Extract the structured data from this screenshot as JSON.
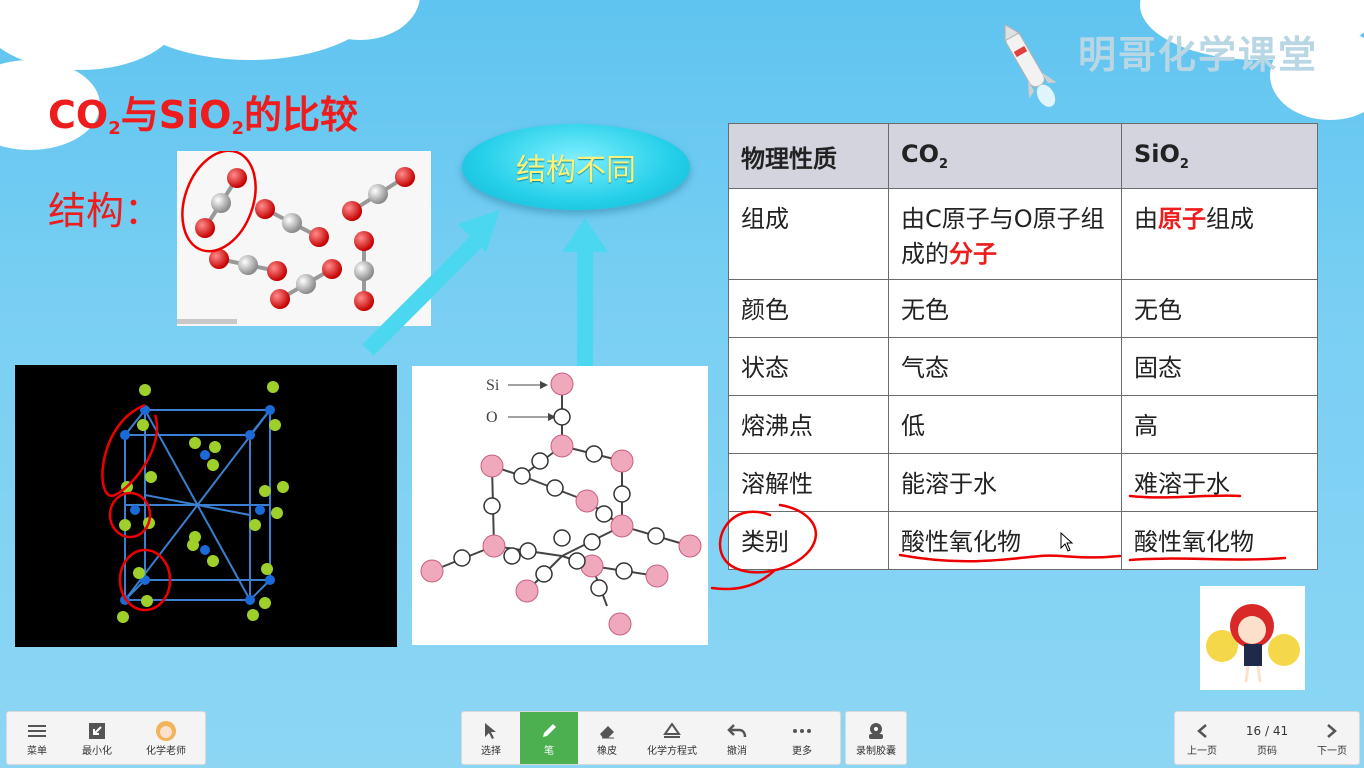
{
  "brand": "明哥化学课堂",
  "title": {
    "part1": "CO",
    "sub1": "2",
    "part2": "与SiO",
    "sub2": "2",
    "part3": "的比较"
  },
  "structure_label": "结构：",
  "bubble_text": "结构不同",
  "diagram_labels": {
    "si": "Si",
    "o": "O"
  },
  "table": {
    "headers": {
      "col1": "物理性质",
      "col2_base": "CO",
      "col2_sub": "2",
      "col3_base": "SiO",
      "col3_sub": "2"
    },
    "rows": [
      {
        "prop": "组成",
        "co2_a": "由C原子与O原子组成的",
        "co2_hl": "分子",
        "sio2_a": "由",
        "sio2_hl": "原子",
        "sio2_b": "组成"
      },
      {
        "prop": "颜色",
        "co2": "无色",
        "sio2": "无色"
      },
      {
        "prop": "状态",
        "co2": "气态",
        "sio2": "固态"
      },
      {
        "prop": "熔沸点",
        "co2": "低",
        "sio2": "高"
      },
      {
        "prop": "溶解性",
        "co2": "能溶于水",
        "sio2": "难溶于水"
      },
      {
        "prop": "类别",
        "co2": "酸性氧化物",
        "sio2": "酸性氧化物"
      }
    ]
  },
  "toolbar": {
    "left": [
      {
        "label": "菜单",
        "icon": "menu-icon"
      },
      {
        "label": "最小化",
        "icon": "minimize-icon"
      },
      {
        "label": "化学老师",
        "icon": "teacher-avatar-icon"
      }
    ],
    "center": [
      {
        "label": "选择",
        "icon": "cursor-icon"
      },
      {
        "label": "笔",
        "icon": "pen-icon"
      },
      {
        "label": "橡皮",
        "icon": "eraser-icon"
      },
      {
        "label": "化学方程式",
        "icon": "equation-icon"
      },
      {
        "label": "撤消",
        "icon": "undo-icon"
      },
      {
        "label": "更多",
        "icon": "more-icon"
      }
    ],
    "record": {
      "label": "录制胶囊",
      "icon": "record-icon"
    },
    "pager": {
      "prev": "上一页",
      "page_label": "页码",
      "next": "下一页",
      "current": "16 / 41"
    }
  },
  "colors": {
    "accent_red": "#ee1c1c",
    "bubble": "#24cfe8",
    "pen_active": "#4caf50"
  }
}
